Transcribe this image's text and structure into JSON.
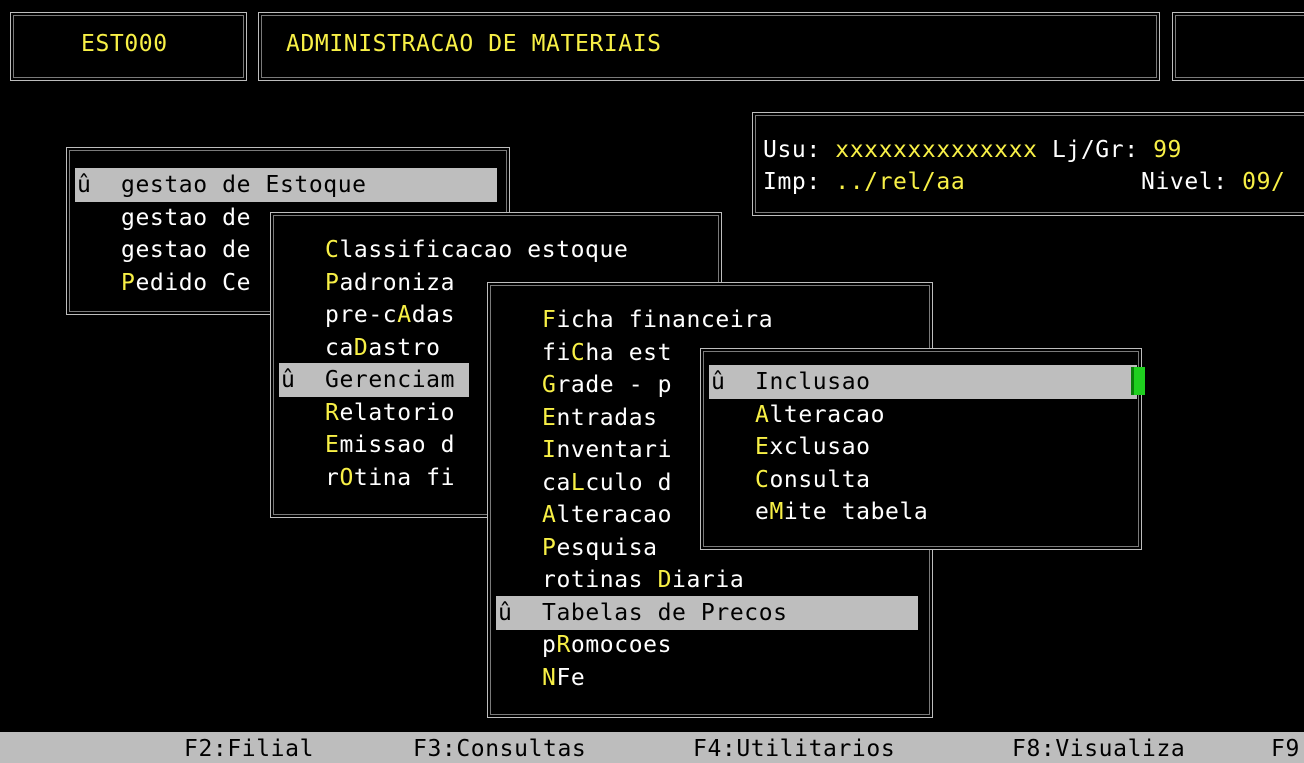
{
  "header": {
    "code": "EST000",
    "title": "ADMINISTRACAO DE MATERIAIS"
  },
  "user_info": {
    "usu_label": "Usu:",
    "usu_value": "xxxxxxxxxxxxxx",
    "ljgr_label": "Lj/Gr:",
    "ljgr_value": "99",
    "imp_label": "Imp:",
    "imp_value": "../rel/aa",
    "nivel_label": "Nivel:",
    "nivel_value": "09/"
  },
  "marker": "û",
  "menu1": {
    "items": [
      {
        "pre": "gestao de ",
        "hk": "E",
        "post": "stoque",
        "selected": true
      },
      {
        "pre": "gestao de",
        "hk": "",
        "post": ""
      },
      {
        "pre": "gestao de",
        "hk": "",
        "post": ""
      },
      {
        "pre": "",
        "hk": "P",
        "post": "edido Ce"
      }
    ]
  },
  "menu2": {
    "items": [
      {
        "pre": "",
        "hk": "C",
        "post": "lassificacao estoque"
      },
      {
        "pre": "",
        "hk": "P",
        "post": "adroniza"
      },
      {
        "pre": "pre-c",
        "hk": "A",
        "post": "das"
      },
      {
        "pre": "ca",
        "hk": "D",
        "post": "astro"
      },
      {
        "pre": "",
        "hk": "G",
        "post": "erenciam",
        "selected": true
      },
      {
        "pre": "",
        "hk": "R",
        "post": "elatorio"
      },
      {
        "pre": "",
        "hk": "E",
        "post": "missao d"
      },
      {
        "pre": "r",
        "hk": "O",
        "post": "tina fi"
      }
    ]
  },
  "menu3": {
    "items": [
      {
        "pre": "",
        "hk": "F",
        "post": "icha financeira"
      },
      {
        "pre": "fi",
        "hk": "C",
        "post": "ha est"
      },
      {
        "pre": "",
        "hk": "G",
        "post": "rade - p"
      },
      {
        "pre": "",
        "hk": "E",
        "post": "ntradas"
      },
      {
        "pre": "",
        "hk": "I",
        "post": "nventari"
      },
      {
        "pre": "ca",
        "hk": "L",
        "post": "culo d"
      },
      {
        "pre": "",
        "hk": "A",
        "post": "lteracao"
      },
      {
        "pre": "",
        "hk": "P",
        "post": "esquisa"
      },
      {
        "pre": "rotinas ",
        "hk": "D",
        "post": "iaria"
      },
      {
        "pre": "",
        "hk": "T",
        "post": "abelas de Precos",
        "selected": true
      },
      {
        "pre": "p",
        "hk": "R",
        "post": "omocoes"
      },
      {
        "pre": "",
        "hk": "N",
        "post": "Fe"
      }
    ]
  },
  "menu4": {
    "items": [
      {
        "pre": "",
        "hk": "I",
        "post": "nclusao",
        "selected": true
      },
      {
        "pre": "",
        "hk": "A",
        "post": "lteracao"
      },
      {
        "pre": "",
        "hk": "E",
        "post": "xclusao"
      },
      {
        "pre": "",
        "hk": "C",
        "post": "onsulta"
      },
      {
        "pre": "e",
        "hk": "M",
        "post": "ite tabela"
      }
    ]
  },
  "function_keys": [
    {
      "label": "F2:Filial"
    },
    {
      "label": "F3:Consultas"
    },
    {
      "label": "F4:Utilitarios"
    },
    {
      "label": "F8:Visualiza"
    },
    {
      "label": "F9"
    }
  ],
  "colors": {
    "background": "#000000",
    "highlight": "#f8f046",
    "selection": "#bebebe",
    "cursor": "#1fd01f"
  }
}
